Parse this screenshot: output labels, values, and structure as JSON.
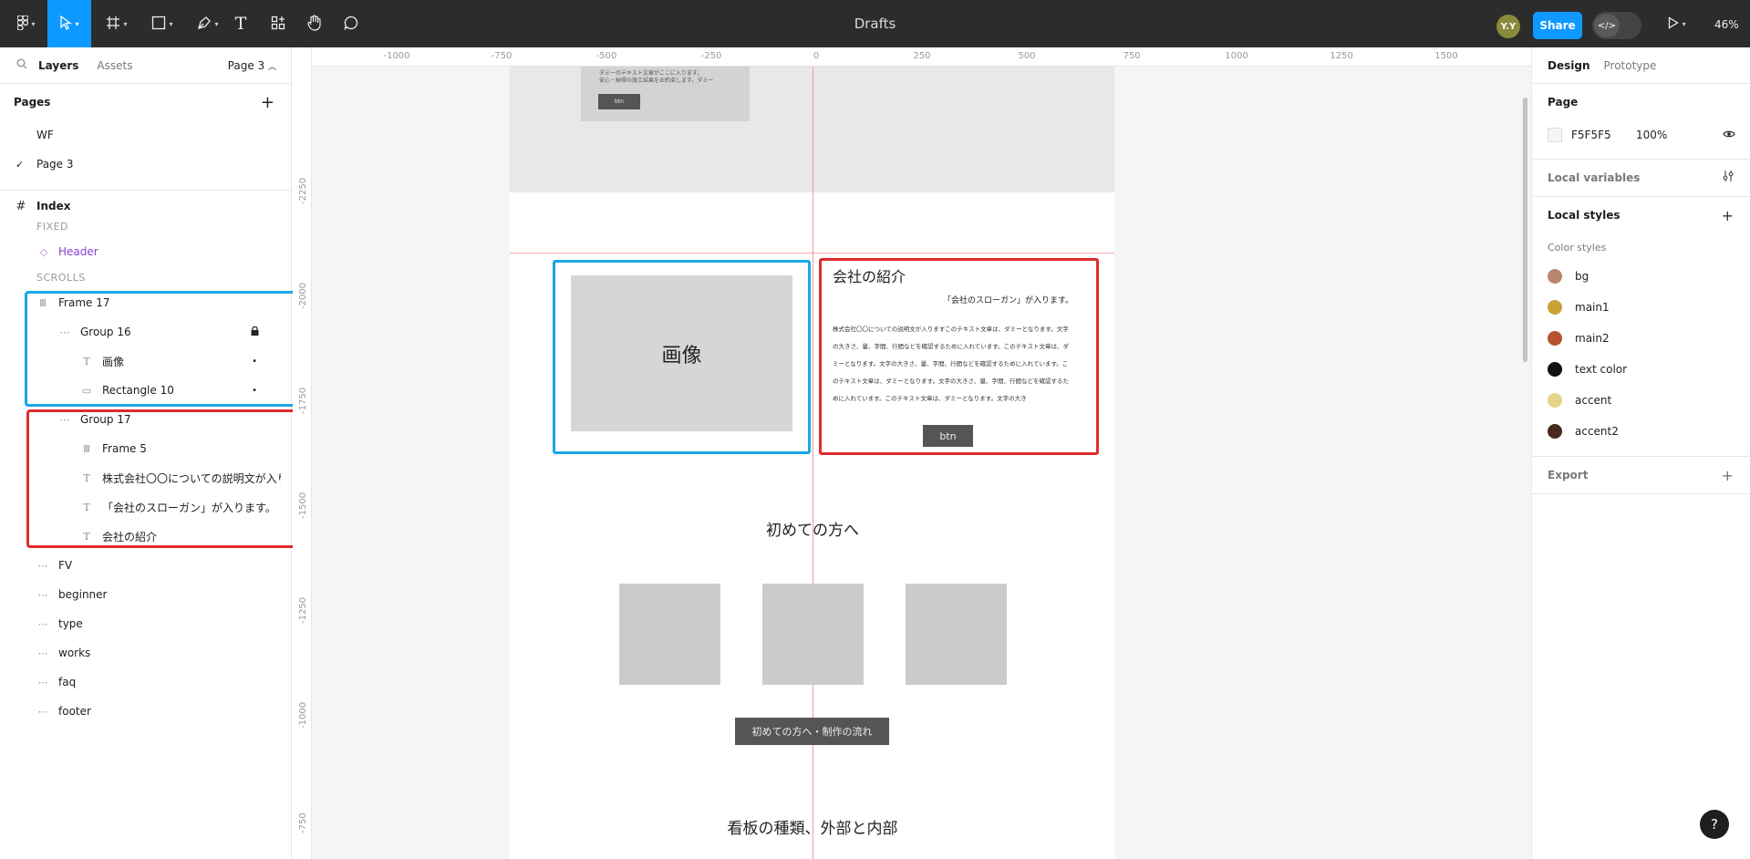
{
  "toolbar": {
    "doc_title": "Drafts",
    "avatar_initials": "Y.Y",
    "share_label": "Share",
    "dev_mode_icon": "</>",
    "zoom": "46%",
    "tools": [
      "main-menu",
      "move",
      "frame",
      "shape",
      "pen",
      "text",
      "resources",
      "hand",
      "comment"
    ]
  },
  "left": {
    "tabs": [
      "Layers",
      "Assets"
    ],
    "page_picker": "Page 3",
    "pages_header": "Pages",
    "pages": [
      {
        "name": "WF",
        "current": false
      },
      {
        "name": "Page 3",
        "current": true
      }
    ],
    "layers": {
      "index": "Index",
      "fixed_label": "FIXED",
      "header": "Header",
      "scrolls_label": "SCROLLS",
      "frame17": "Frame 17",
      "group16": "Group 16",
      "gazo": "画像",
      "rect10": "Rectangle 10",
      "group17": "Group 17",
      "frame5": "Frame 5",
      "desc": "株式会社〇〇についての説明文が入り...",
      "slogan": "「会社のスローガン」が入ります。",
      "intro": "会社の紹介",
      "fv": "FV",
      "beginner": "beginner",
      "type": "type",
      "works": "works",
      "faq": "faq",
      "footer": "footer"
    }
  },
  "canvas": {
    "ruler_x": [
      "-1000",
      "-750",
      "-500",
      "-250",
      "0",
      "250",
      "500",
      "750",
      "1000",
      "1250",
      "1500"
    ],
    "ruler_y": [
      "-2250",
      "-2000",
      "-1750",
      "-1500",
      "-1250",
      "-1000",
      "-750"
    ],
    "fv_card_text": "ダミーのテキスト文章がここに入ります。\n安心・納得の施工結果をお約束します。ダミー",
    "fv_btn": "btn",
    "image_label": "画像",
    "company_title": "会社の紹介",
    "company_slogan": "「会社のスローガン」が入ります。",
    "company_body": "株式会社〇〇についての説明文が入りますこのテキスト文章は、ダミーとなります。文字の大きさ、量、字間、行間などを確認するために入れています。このテキスト文章は、ダミーとなります。文字の大きさ、量、字間、行間などを確認するために入れています。このテキスト文章は、ダミーとなります。文字の大きさ、量、字間、行間などを確認するために入れています。このテキスト文章は、ダミーとなります。文字の大き",
    "company_btn": "btn",
    "beginner_title": "初めての方へ",
    "beginner_btn": "初めての方へ・制作の流れ",
    "type_title": "看板の種類、外部と内部"
  },
  "right": {
    "tabs": [
      "Design",
      "Prototype"
    ],
    "page_header": "Page",
    "page_color": "F5F5F5",
    "page_opacity": "100%",
    "local_variables": "Local variables",
    "local_styles": "Local styles",
    "color_styles_label": "Color styles",
    "color_styles": [
      {
        "name": "bg",
        "color": "#b8866a"
      },
      {
        "name": "main1",
        "color": "#c9a136"
      },
      {
        "name": "main2",
        "color": "#b5542c"
      },
      {
        "name": "text color",
        "color": "#111111"
      },
      {
        "name": "accent",
        "color": "#e5d58a"
      },
      {
        "name": "accent2",
        "color": "#4a2a1c"
      }
    ],
    "export": "Export",
    "help": "?"
  },
  "colors": {
    "accent": "#0d99ff",
    "toolbar_bg": "#2c2c2c",
    "highlight_blue": "#19a7e6",
    "highlight_red": "#e02b2b"
  }
}
